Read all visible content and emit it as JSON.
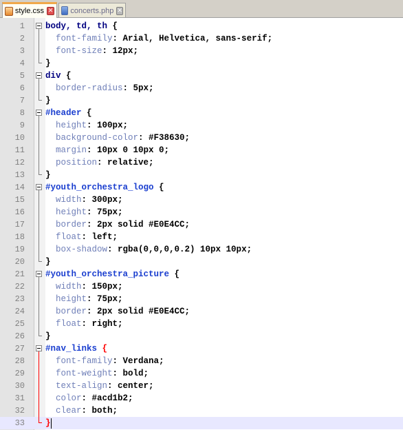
{
  "tabs": [
    {
      "label": "style.css",
      "active": true,
      "icon": "css-file-icon"
    },
    {
      "label": "concerts.php",
      "active": false,
      "icon": "php-file-icon"
    }
  ],
  "colors": {
    "accent_tab": "#f0a84a",
    "current_line": "#e8e8ff",
    "brace_match": "#ff0000"
  },
  "editor": {
    "current_line": 33,
    "lines": [
      {
        "n": "1",
        "tokens": [
          [
            "sel",
            "body, td, th "
          ],
          [
            "brace",
            "{"
          ]
        ]
      },
      {
        "n": "2",
        "tokens": [
          [
            "val",
            "  "
          ],
          [
            "prop",
            "font-family"
          ],
          [
            "val",
            ": Arial, Helvetica, sans-serif;"
          ]
        ]
      },
      {
        "n": "3",
        "tokens": [
          [
            "val",
            "  "
          ],
          [
            "prop",
            "font-size"
          ],
          [
            "val",
            ": 12px;"
          ]
        ]
      },
      {
        "n": "4",
        "tokens": [
          [
            "brace",
            "}"
          ]
        ]
      },
      {
        "n": "5",
        "tokens": [
          [
            "sel",
            "div "
          ],
          [
            "brace",
            "{"
          ]
        ]
      },
      {
        "n": "6",
        "tokens": [
          [
            "val",
            "  "
          ],
          [
            "prop",
            "border-radius"
          ],
          [
            "val",
            ": 5px;"
          ]
        ]
      },
      {
        "n": "7",
        "tokens": [
          [
            "brace",
            "}"
          ]
        ]
      },
      {
        "n": "8",
        "tokens": [
          [
            "id",
            "#header "
          ],
          [
            "brace",
            "{"
          ]
        ]
      },
      {
        "n": "9",
        "tokens": [
          [
            "val",
            "  "
          ],
          [
            "prop",
            "height"
          ],
          [
            "val",
            ": 100px;"
          ]
        ]
      },
      {
        "n": "10",
        "tokens": [
          [
            "val",
            "  "
          ],
          [
            "prop",
            "background-color"
          ],
          [
            "val",
            ": #F38630;"
          ]
        ]
      },
      {
        "n": "11",
        "tokens": [
          [
            "val",
            "  "
          ],
          [
            "prop",
            "margin"
          ],
          [
            "val",
            ": 10px 0 10px 0;"
          ]
        ]
      },
      {
        "n": "12",
        "tokens": [
          [
            "val",
            "  "
          ],
          [
            "prop",
            "position"
          ],
          [
            "val",
            ": relative;"
          ]
        ]
      },
      {
        "n": "13",
        "tokens": [
          [
            "brace",
            "}"
          ]
        ]
      },
      {
        "n": "14",
        "tokens": [
          [
            "id",
            "#youth_orchestra_logo "
          ],
          [
            "brace",
            "{"
          ]
        ]
      },
      {
        "n": "15",
        "tokens": [
          [
            "val",
            "  "
          ],
          [
            "prop",
            "width"
          ],
          [
            "val",
            ": 300px;"
          ]
        ]
      },
      {
        "n": "16",
        "tokens": [
          [
            "val",
            "  "
          ],
          [
            "prop",
            "height"
          ],
          [
            "val",
            ": 75px;"
          ]
        ]
      },
      {
        "n": "17",
        "tokens": [
          [
            "val",
            "  "
          ],
          [
            "prop",
            "border"
          ],
          [
            "val",
            ": 2px solid #E0E4CC;"
          ]
        ]
      },
      {
        "n": "18",
        "tokens": [
          [
            "val",
            "  "
          ],
          [
            "prop",
            "float"
          ],
          [
            "val",
            ": left;"
          ]
        ]
      },
      {
        "n": "19",
        "tokens": [
          [
            "val",
            "  "
          ],
          [
            "prop",
            "box-shadow"
          ],
          [
            "val",
            ": rgba(0,0,0,0.2) 10px 10px;"
          ]
        ]
      },
      {
        "n": "20",
        "tokens": [
          [
            "brace",
            "}"
          ]
        ]
      },
      {
        "n": "21",
        "tokens": [
          [
            "id",
            "#youth_orchestra_picture "
          ],
          [
            "brace",
            "{"
          ]
        ]
      },
      {
        "n": "22",
        "tokens": [
          [
            "val",
            "  "
          ],
          [
            "prop",
            "width"
          ],
          [
            "val",
            ": 150px;"
          ]
        ]
      },
      {
        "n": "23",
        "tokens": [
          [
            "val",
            "  "
          ],
          [
            "prop",
            "height"
          ],
          [
            "val",
            ": 75px;"
          ]
        ]
      },
      {
        "n": "24",
        "tokens": [
          [
            "val",
            "  "
          ],
          [
            "prop",
            "border"
          ],
          [
            "val",
            ": 2px solid #E0E4CC;"
          ]
        ]
      },
      {
        "n": "25",
        "tokens": [
          [
            "val",
            "  "
          ],
          [
            "prop",
            "float"
          ],
          [
            "val",
            ": right;"
          ]
        ]
      },
      {
        "n": "26",
        "tokens": [
          [
            "brace",
            "}"
          ]
        ]
      },
      {
        "n": "27",
        "tokens": [
          [
            "id",
            "#nav_links "
          ],
          [
            "brace-hl",
            "{"
          ]
        ]
      },
      {
        "n": "28",
        "tokens": [
          [
            "val",
            "  "
          ],
          [
            "prop",
            "font-family"
          ],
          [
            "val",
            ": Verdana;"
          ]
        ]
      },
      {
        "n": "29",
        "tokens": [
          [
            "val",
            "  "
          ],
          [
            "prop",
            "font-weight"
          ],
          [
            "val",
            ": bold;"
          ]
        ]
      },
      {
        "n": "30",
        "tokens": [
          [
            "val",
            "  "
          ],
          [
            "prop",
            "text-align"
          ],
          [
            "val",
            ": center;"
          ]
        ]
      },
      {
        "n": "31",
        "tokens": [
          [
            "val",
            "  "
          ],
          [
            "prop",
            "color"
          ],
          [
            "val",
            ": #acd1b2;"
          ]
        ]
      },
      {
        "n": "32",
        "tokens": [
          [
            "val",
            "  "
          ],
          [
            "prop",
            "clear"
          ],
          [
            "val",
            ": both;"
          ]
        ]
      },
      {
        "n": "33",
        "tokens": [
          [
            "brace-hl",
            "}"
          ]
        ]
      }
    ]
  }
}
